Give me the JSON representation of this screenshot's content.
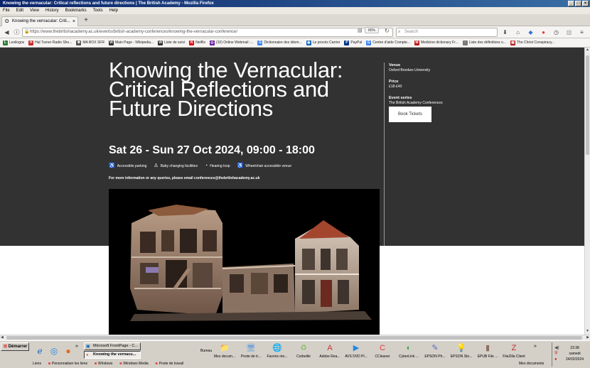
{
  "window": {
    "title": "Knowing the vernacular: Critical reflections and future directions | The British Academy - Mozilla Firefox"
  },
  "menu": [
    "File",
    "Edit",
    "View",
    "History",
    "Bookmarks",
    "Tools",
    "Help"
  ],
  "tab": {
    "label": "Knowing the vernacular: Criti...",
    "new_tab": "+"
  },
  "nav": {
    "url": "https://www.thebritishacademy.ac.uk/events/british-academy-conferences/knowing-the-vernacular-conference/",
    "zoom": "80%",
    "search_placeholder": "Search"
  },
  "bookmarks": [
    {
      "label": "Lexilogos",
      "icon": "L",
      "color": "#2e7d32"
    },
    {
      "label": "Hal Turner Radio Sho...",
      "icon": "H",
      "color": "#c62828"
    },
    {
      "label": "MA BOX SFR",
      "icon": "✱",
      "color": "#555555"
    },
    {
      "label": "Main Page - Wikipedia...",
      "icon": "W",
      "color": "#333333"
    },
    {
      "label": "Liste de suivi",
      "icon": "W",
      "color": "#333333"
    },
    {
      "label": "Netflix",
      "icon": "N",
      "color": "#e50914"
    },
    {
      "label": "(10) Online Webmail :...",
      "icon": "◎",
      "color": "#6a1b9a"
    },
    {
      "label": "Dictionnaire des idiom...",
      "icon": "G",
      "color": "#4285f4"
    },
    {
      "label": "Le procès Carrier",
      "icon": "◉",
      "color": "#1565c0"
    },
    {
      "label": "PayPal",
      "icon": "P",
      "color": "#003087"
    },
    {
      "label": "Centre d'aide Compte...",
      "icon": "G",
      "color": "#4285f4"
    },
    {
      "label": "Medicine dictionary Fr...",
      "icon": "M",
      "color": "#b71c1c"
    },
    {
      "label": "Liste des définitions o...",
      "icon": "◌",
      "color": "#777777"
    },
    {
      "label": "The Christ Conspiracy...",
      "icon": "▣",
      "color": "#b71c1c"
    }
  ],
  "page": {
    "title": "Knowing the Vernacular: Critical Reflections and Future Directions",
    "date": "Sat 26 - Sun 27 Oct 2024, 09:00 - 18:00",
    "amenities": [
      {
        "label": "Accessible parking",
        "icon": "accessible-parking-icon",
        "glyph": "♿"
      },
      {
        "label": "Baby changing facilities",
        "icon": "baby-changing-icon",
        "glyph": "♙"
      },
      {
        "label": "Hearing loop",
        "icon": "hearing-loop-icon",
        "glyph": "◔"
      },
      {
        "label": "Wheelchair accessible venue",
        "icon": "wheelchair-icon",
        "glyph": "♿"
      }
    ],
    "info": "For more information or any queries, please email conferences@thebritishacademy.ac.uk",
    "sidebar": {
      "venue_label": "Venue",
      "venue": "Oxford Brookes University",
      "price_label": "Price",
      "price": "£18-£40",
      "series_label": "Event series",
      "series": "The British Academy Conferences",
      "book_button": "Book Tickets"
    }
  },
  "taskbar": {
    "start": "Démarrer",
    "tasks": [
      {
        "label": "Microsoft FrontPage - C...",
        "active": false
      },
      {
        "label": "Knowing the vernacu...",
        "active": true
      }
    ],
    "bureau": "Bureau",
    "desktop_icons": [
      {
        "label": "Mes docum...",
        "icon": "my-documents-icon",
        "glyph": "📁",
        "color": "#f2c14e"
      },
      {
        "label": "Poste de tr...",
        "icon": "my-computer-icon",
        "glyph": "🖥",
        "color": "#7aa7d9"
      },
      {
        "label": "Favoris rés...",
        "icon": "network-favorites-icon",
        "glyph": "🌐",
        "color": "#4f9fd8"
      },
      {
        "label": "Corbeille",
        "icon": "recycle-bin-icon",
        "glyph": "♻",
        "color": "#8bbf6a"
      },
      {
        "label": "Adobe Rea...",
        "icon": "adobe-reader-icon",
        "glyph": "A",
        "color": "#d32f2f"
      },
      {
        "label": "AVS DVD Pl...",
        "icon": "dvd-player-icon",
        "glyph": "▶",
        "color": "#1e88e5"
      },
      {
        "label": "CCleaner",
        "icon": "ccleaner-icon",
        "glyph": "C",
        "color": "#e53935"
      },
      {
        "label": "CyberLink ...",
        "icon": "cyberlink-icon",
        "glyph": "◐",
        "color": "#43a047"
      },
      {
        "label": "EPSON Ph...",
        "icon": "epson-photo-icon",
        "glyph": "✎",
        "color": "#5c6bc0"
      },
      {
        "label": "EPSON Sto...",
        "icon": "epson-store-icon",
        "glyph": "💡",
        "color": "#fdd835"
      },
      {
        "label": "EPUB File ...",
        "icon": "epub-file-icon",
        "glyph": "▮",
        "color": "#8d6e63"
      },
      {
        "label": "FileZilla Client",
        "icon": "filezilla-icon",
        "glyph": "Z",
        "color": "#c62828"
      }
    ],
    "links": [
      "Liens",
      "Personnaliser les liens",
      "Windows",
      "Windows Media",
      "Poste de travail"
    ],
    "mes_documents": "Mes documents",
    "clock": {
      "time": "23:38",
      "day": "samedi",
      "date": "24/02/2024"
    }
  }
}
